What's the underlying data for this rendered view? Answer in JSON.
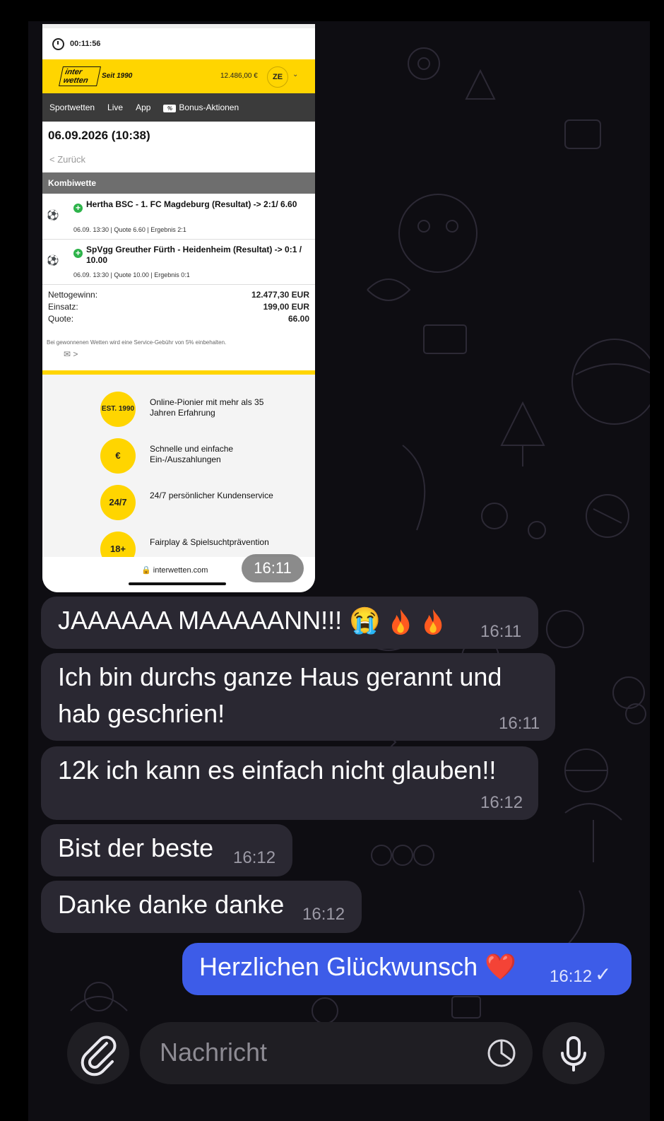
{
  "screenshot": {
    "status_time": "00:11:56",
    "logo_line1": "inter",
    "logo_line2": "wetten",
    "since": "Seit 1990",
    "balance": "12.486,00 €",
    "avatar": "ZE",
    "nav": [
      "Sportwetten",
      "Live",
      "App",
      "Bonus-Aktionen"
    ],
    "bet_date": "06.09.2026 (10:38)",
    "back": "Zurück",
    "bet_type": "Kombiwette",
    "legs": [
      {
        "title": "Hertha BSC - 1. FC Magdeburg (Resultat) -> 2:1/ 6.60",
        "meta": "06.09. 13:30 | Quote 6.60  | Ergebnis 2:1"
      },
      {
        "title": "SpVgg Greuther Fürth - Heidenheim (Resultat) -> 0:1 / 10.00",
        "meta": "06.09. 13:30 | Quote 10.00  | Ergebnis 0:1"
      }
    ],
    "summary": [
      {
        "label": "Nettogewinn:",
        "value": "12.477,30 EUR"
      },
      {
        "label": "Einsatz:",
        "value": "199,00 EUR"
      },
      {
        "label": "Quote:",
        "value": "66.00"
      }
    ],
    "fee_note": "Bei gewonnenen Wetten wird eine Service-Gebühr von 5% einbehalten.",
    "features": [
      {
        "badge": "EST. 1990",
        "text": "Online-Pionier mit mehr als 35 Jahren Erfahrung"
      },
      {
        "badge": "€",
        "text": "Schnelle und einfache Ein-/Auszahlungen"
      },
      {
        "badge": "24/7",
        "text": "24/7 persönlicher Kundenservice"
      },
      {
        "badge": "18+",
        "text": "Fairplay & Spielsuchtprävention"
      }
    ],
    "url": "interwetten.com",
    "message_time": "16:11"
  },
  "messages": [
    {
      "text": "JAAAAAA MAAAAANN!!! 😭",
      "time": "16:11",
      "direction": "in"
    },
    {
      "line1": "Ich bin durchs ganze Haus gerannt und",
      "line2": "hab geschrien!",
      "time": "16:11",
      "direction": "in"
    },
    {
      "text": "12k ich kann es einfach nicht glauben!!",
      "time": "16:12",
      "direction": "in"
    },
    {
      "text": "Bist der beste",
      "time": "16:12",
      "direction": "in"
    },
    {
      "text": "Danke danke danke",
      "time": "16:12",
      "direction": "in"
    },
    {
      "text": "Herzlichen Glückwunsch ❤️",
      "time": "16:12",
      "direction": "out"
    }
  ],
  "input": {
    "placeholder": "Nachricht"
  },
  "colors": {
    "outgoing": "#3d5ce8",
    "incoming": "#2a2832",
    "brand_yellow": "#ffd500"
  }
}
